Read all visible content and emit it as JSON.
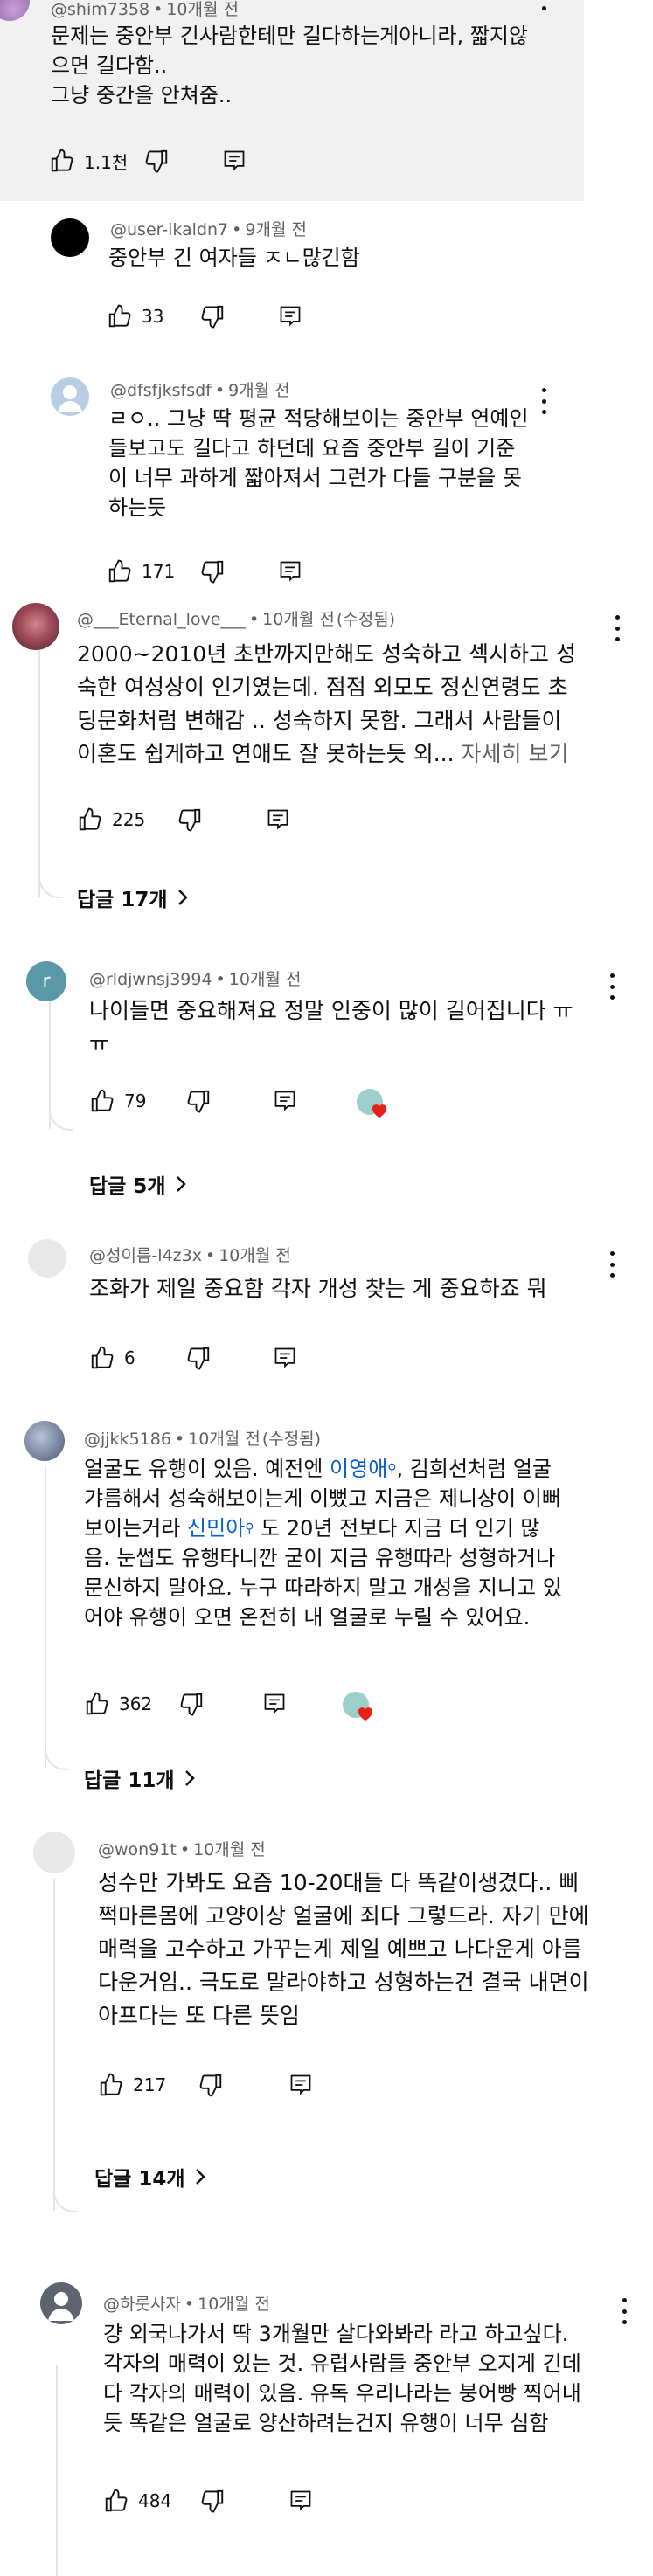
{
  "comments": [
    {
      "author": "@shim7358",
      "time": "10개월 전",
      "lines": [
        "문제는 중안부 긴사람한테만 길다하는게아니라, 짧지않",
        "으면 길다함..",
        "그냥 중간을 안쳐줌.."
      ],
      "likes": "1.1천"
    },
    {
      "author": "@user-ikaldn7",
      "time": "9개월 전",
      "lines": [
        "중안부 긴 여자들 ㅈㄴ많긴함"
      ],
      "likes": "33"
    },
    {
      "author": "@dfsfjksfsdf",
      "time": "9개월 전",
      "lines": [
        "ㄹㅇ.. 그냥 딱 평균 적당해보이는 중안부 연예인",
        "들보고도 길다고 하던데 요즘 중안부 길이 기준",
        "이 너무 과하게 짧아져서 그런가 다들 구분을 못",
        "하는듯"
      ],
      "likes": "171"
    },
    {
      "author": "@___Eternal_love___",
      "time": "10개월 전",
      "edited": "(수정됨)",
      "lines": [
        "2000~2010년 초반까지만해도 성숙하고 섹시하고 성",
        "숙한 여성상이 인기였는데. 점점 외모도 정신연령도 초",
        "딩문화처럼 변해감 .. 성숙하지 못함. 그래서 사람들이",
        "이혼도 쉽게하고 연애도 잘 못하는듯 외..."
      ],
      "more": "자세히 보기",
      "likes": "225",
      "replies": "답글 17개"
    },
    {
      "author": "@rldjwnsj3994",
      "time": "10개월 전",
      "avatar_letter": "r",
      "lines": [
        "나이들면 중요해져요 정말 인중이 많이 길어집니다 ㅠ",
        "ㅠ"
      ],
      "likes": "79",
      "replies": "답글 5개"
    },
    {
      "author": "@성이름-l4z3x",
      "time": "10개월 전",
      "lines": [
        "조화가 제일 중요함 각자 개성 찾는 게 중요하죠 뭐"
      ],
      "likes": "6"
    },
    {
      "author": "@jjkk5186",
      "time": "10개월 전",
      "edited": "(수정됨)",
      "line1_a": "얼굴도 유행이 있음. 예전엔 ",
      "mention1": "이영애",
      "line1_b": ", 김희선처럼 얼굴",
      "line2": "갸름해서 성숙해보이는게 이뻤고 지금은 제니상이 이뻐",
      "line3_a": "보이는거라 ",
      "mention2": "신민아",
      "line3_b": " 도 20년 전보다 지금 더 인기 많",
      "lines_rest": [
        "음. 눈썹도 유행타니깐 굳이 지금 유행따라 성형하거나",
        "문신하지 말아요. 누구 따라하지 말고 개성을 지니고 있",
        "어야 유행이 오면 온전히 내 얼굴로 누릴 수 있어요."
      ],
      "likes": "362",
      "replies": "답글 11개"
    },
    {
      "author": "@won91t",
      "time": "10개월 전",
      "lines": [
        "성수만 가봐도 요즘 10-20대들 다 똑같이생겼다.. 삐",
        "쩍마른몸에 고양이상 얼굴에 죄다 그렇드라. 자기 만에",
        "매력을 고수하고 가꾸는게 제일 예쁘고 나다운게 아름",
        "다운거임.. 극도로 말라야하고 성형하는건 결국 내면이",
        "아프다는 또 다른 뜻임"
      ],
      "likes": "217",
      "replies": "답글 14개"
    },
    {
      "author": "@하룻사자",
      "time": "10개월 전",
      "lines": [
        "걍 외국나가서 딱 3개월만 살다와봐라 라고 하고싶다.",
        "각자의 매력이 있는 것. 유럽사람들 중안부 오지게 긴데",
        "다 각자의 매력이 있음. 유독 우리나라는 붕어빵 찍어내",
        "듯 똑같은 얼굴로 양산하려는건지 유행이 너무 심함"
      ],
      "likes": "484"
    }
  ],
  "icons": {
    "like": "thumbs-up-icon",
    "dislike": "thumbs-down-icon",
    "reply": "comment-reply-icon",
    "more": "more-vert-icon",
    "heart": "creator-heart-icon",
    "chevron": "chevron-right-icon"
  },
  "colors": {
    "mention": "#065fd4",
    "secondary": "#606060",
    "heart": "#e62117"
  }
}
